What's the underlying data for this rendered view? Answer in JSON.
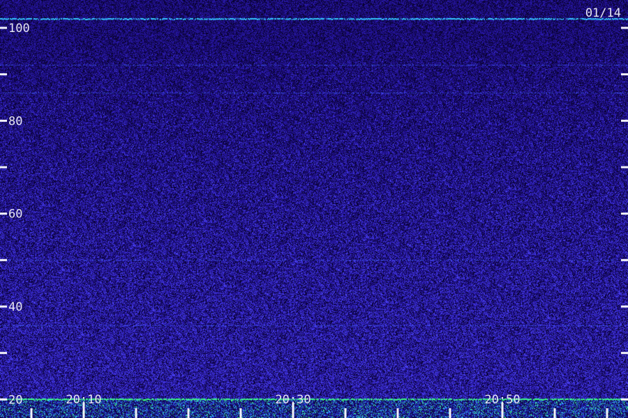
{
  "date_label": "01/14",
  "chart_data": {
    "type": "heatmap",
    "title": "",
    "xlabel": "",
    "ylabel": "",
    "y_range": [
      16,
      106
    ],
    "x_range": [
      "20:02",
      "21:02"
    ],
    "y_ticks": [
      100,
      80,
      60,
      40,
      20
    ],
    "y_minor_ticks": [
      90,
      70,
      50,
      30
    ],
    "x_tick_labels": [
      "20:10",
      "20:30",
      "20:50"
    ],
    "x_minor_ticks": [
      "20:05",
      "20:15",
      "20:20",
      "20:25",
      "20:35",
      "20:40",
      "20:45",
      "20:55",
      "21:00"
    ],
    "strong_lines": [
      102,
      20
    ],
    "weak_lines": [
      92,
      86,
      50,
      36
    ],
    "colors": {
      "background": "#1a0b5c",
      "noise_low": "#0a0330",
      "noise_high": "#3b2ee0",
      "line_cyan": "#33c6ff",
      "line_green": "#3cff8a",
      "text": "#e6e6f2"
    }
  }
}
